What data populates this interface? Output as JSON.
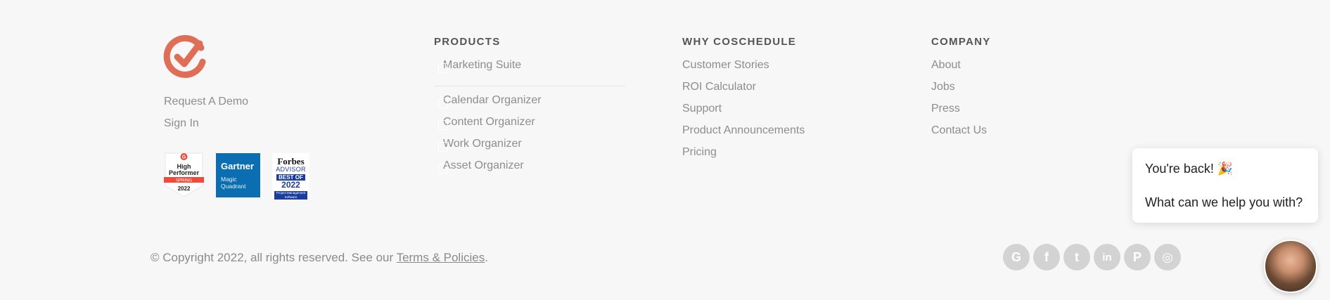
{
  "brand": {
    "logo_icon": "coschedule-check-logo-icon",
    "logo_color": "#e06d55"
  },
  "left": {
    "links": [
      "Request A Demo",
      "Sign In"
    ],
    "badges": {
      "g2": {
        "top": "G",
        "line1": "High",
        "line2": "Performer",
        "season": "SPRING",
        "year": "2022"
      },
      "gartner": {
        "name": "Gartner",
        "line1": "Magic",
        "line2": "Quadrant"
      },
      "forbes": {
        "name": "Forbes",
        "advisor": "ADVISOR",
        "best_of": "BEST OF",
        "year": "2022",
        "category": "Project Management Software"
      }
    }
  },
  "products": {
    "heading": "PRODUCTS",
    "items": [
      "Marketing Suite",
      "Calendar Organizer",
      "Content Organizer",
      "Work Organizer",
      "Asset Organizer"
    ]
  },
  "why": {
    "heading": "WHY COSCHEDULE",
    "items": [
      "Customer Stories",
      "ROI Calculator",
      "Support",
      "Product Announcements",
      "Pricing"
    ]
  },
  "company": {
    "heading": "COMPANY",
    "items": [
      "About",
      "Jobs",
      "Press",
      "Contact Us"
    ]
  },
  "footer": {
    "copyright_prefix": "© Copyright 2022, all rights reserved. See our ",
    "terms_link": "Terms & Policies",
    "copyright_suffix": "."
  },
  "social": {
    "icons": [
      "g2-icon",
      "facebook-icon",
      "twitter-icon",
      "linkedin-icon",
      "pinterest-icon",
      "instagram-icon"
    ],
    "glyphs": [
      "G",
      "f",
      "t",
      "in",
      "P",
      "◎"
    ]
  },
  "chat": {
    "line1": "You're back! 🎉",
    "line2": "What can we help you with?"
  }
}
